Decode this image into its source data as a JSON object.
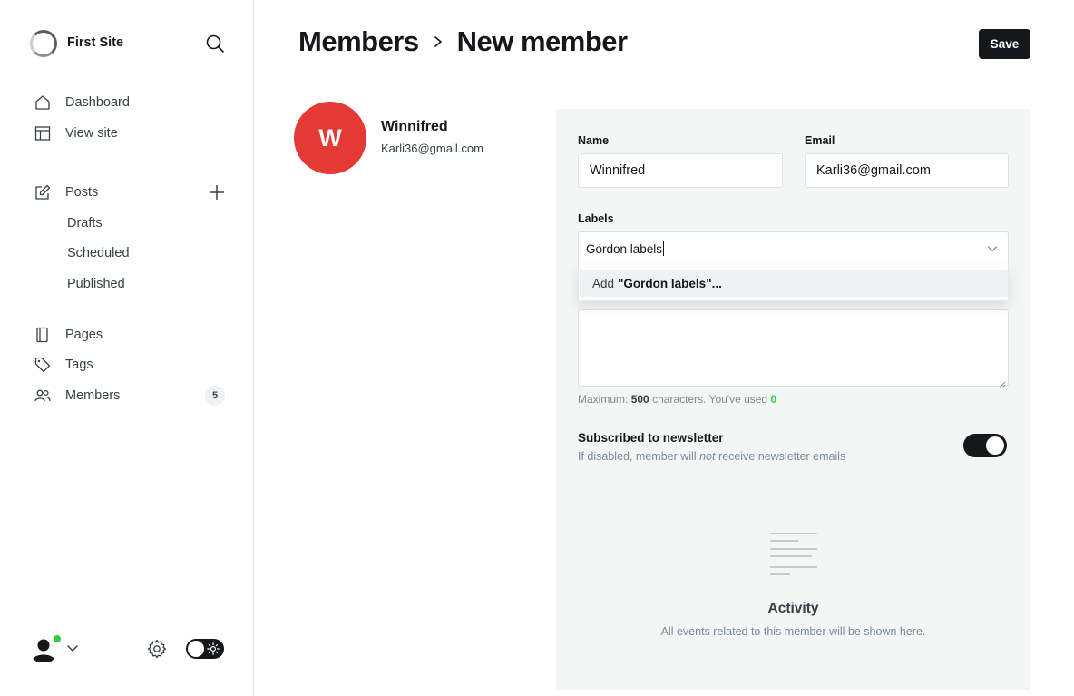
{
  "sidebar": {
    "site_title": "First Site",
    "nav": [
      {
        "label": "Dashboard",
        "icon": "home-icon"
      },
      {
        "label": "View site",
        "icon": "layout-icon"
      }
    ],
    "posts": {
      "label": "Posts",
      "icon": "edit-icon"
    },
    "post_subitems": [
      "Drafts",
      "Scheduled",
      "Published"
    ],
    "pages": {
      "label": "Pages"
    },
    "tags": {
      "label": "Tags"
    },
    "members": {
      "label": "Members",
      "count": "5"
    }
  },
  "header": {
    "crumb_parent": "Members",
    "crumb_current": "New member",
    "save_label": "Save"
  },
  "member": {
    "initial": "W",
    "name": "Winnifred",
    "email": "Karli36@gmail.com",
    "avatar_color": "#e53935"
  },
  "form": {
    "name_label": "Name",
    "name_value": "Winnifred",
    "email_label": "Email",
    "email_value": "Karli36@gmail.com",
    "labels_label": "Labels",
    "labels_value": "Gordon labels",
    "dropdown_prefix": "Add",
    "dropdown_value": "\"Gordon labels\"...",
    "char_prefix": "Maximum:",
    "char_max": "500",
    "char_middle": "characters. You've used",
    "char_used": "0"
  },
  "newsletter": {
    "title": "Subscribed to newsletter",
    "desc_before": "If disabled, member will",
    "desc_emph": "not",
    "desc_after": "receive newsletter emails",
    "enabled": true
  },
  "activity": {
    "title": "Activity",
    "desc": "All events related to this member will be shown here."
  },
  "colors": {
    "accent_dark": "#15171a",
    "success": "#30cf43",
    "panel_bg": "#f4f5f5"
  }
}
